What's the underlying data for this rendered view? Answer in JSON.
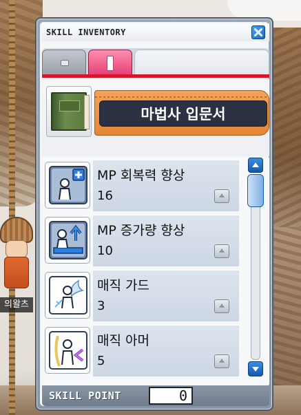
{
  "window": {
    "title": "SKILL INVENTORY"
  },
  "job": {
    "name": "마법사 입문서"
  },
  "skills": [
    {
      "name": "MP 회복력 향상",
      "level": "16",
      "icon": "mp-recovery-icon"
    },
    {
      "name": "MP 증가량 향상",
      "level": "10",
      "icon": "mp-increase-icon"
    },
    {
      "name": "매직 가드",
      "level": "3",
      "icon": "magic-guard-icon"
    },
    {
      "name": "매직 아머",
      "level": "5",
      "icon": "magic-armor-icon"
    }
  ],
  "footer": {
    "label": "SKILL POINT",
    "value": "0"
  },
  "scene": {
    "player_name": "의왈츠"
  },
  "colors": {
    "tab_active": "#e7407a",
    "accent_red": "#d8152a",
    "job_plate": "#e58634",
    "scroll_blue": "#1558b1"
  }
}
